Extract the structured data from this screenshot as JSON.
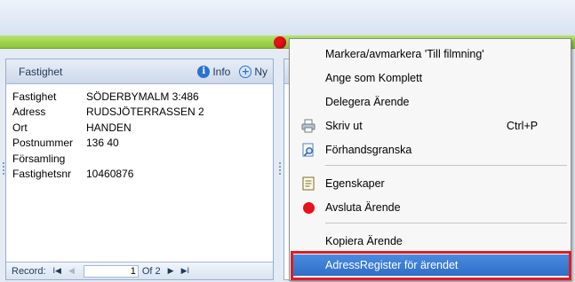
{
  "panel": {
    "title": "Fastighet",
    "info_label": "Info",
    "new_label": "Ny",
    "fields": [
      {
        "label": "Fastighet",
        "value": "SÖDERBYMALM 3:486"
      },
      {
        "label": "Adress",
        "value": "RUDSJÖTERRASSEN 2"
      },
      {
        "label": "Ort",
        "value": "HANDEN"
      },
      {
        "label": "Postnummer",
        "value": "136 40"
      },
      {
        "label": "Församling",
        "value": ""
      },
      {
        "label": "Fastighetsnr",
        "value": "10460876"
      }
    ],
    "navigator": {
      "record_label": "Record:",
      "first_glyph": "I◀",
      "prev_glyph": "◀",
      "current": "1",
      "of_text": "Of 2",
      "next_glyph": "▶",
      "last_glyph": "▶I"
    }
  },
  "menu": {
    "items": [
      {
        "label": "Markera/avmarkera 'Till filmning'",
        "shortcut": "",
        "icon": ""
      },
      {
        "label": "Ange som Komplett",
        "shortcut": "",
        "icon": ""
      },
      {
        "label": "Delegera Ärende",
        "shortcut": "",
        "icon": ""
      },
      {
        "label": "Skriv ut",
        "shortcut": "Ctrl+P",
        "icon": "printer-icon"
      },
      {
        "label": "Förhandsgranska",
        "shortcut": "",
        "icon": "preview-icon"
      },
      {
        "label": "Egenskaper",
        "shortcut": "",
        "icon": "properties-icon"
      },
      {
        "label": "Avsluta Ärende",
        "shortcut": "",
        "icon": "red-circle-icon"
      },
      {
        "label": "Kopiera Ärende",
        "shortcut": "",
        "icon": ""
      },
      {
        "label": "AdressRegister för ärendet",
        "shortcut": "",
        "icon": ""
      }
    ],
    "highlighted_index": 8
  },
  "colors": {
    "menu_highlight": "#2f6fc8",
    "status_green": "#8cc43a",
    "alert_red": "#e8101a",
    "outline_red": "#e01b24"
  }
}
